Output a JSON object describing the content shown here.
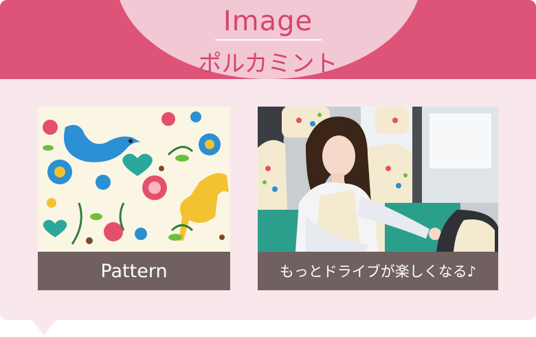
{
  "header": {
    "title_en": "Image",
    "title_jp": "ポルカミント"
  },
  "tiles": [
    {
      "caption": "Pattern",
      "image": "floral-pattern-image"
    },
    {
      "caption": "もっとドライブが楽しくなる♪",
      "image": "car-interior-photo"
    }
  ],
  "colors": {
    "header_band": "#de5378",
    "header_oval": "#f2c8d5",
    "title_text": "#d6456c",
    "panel_bg": "#f8e8ec",
    "caption_bg": "#706060",
    "caption_text": "#ffffff"
  }
}
